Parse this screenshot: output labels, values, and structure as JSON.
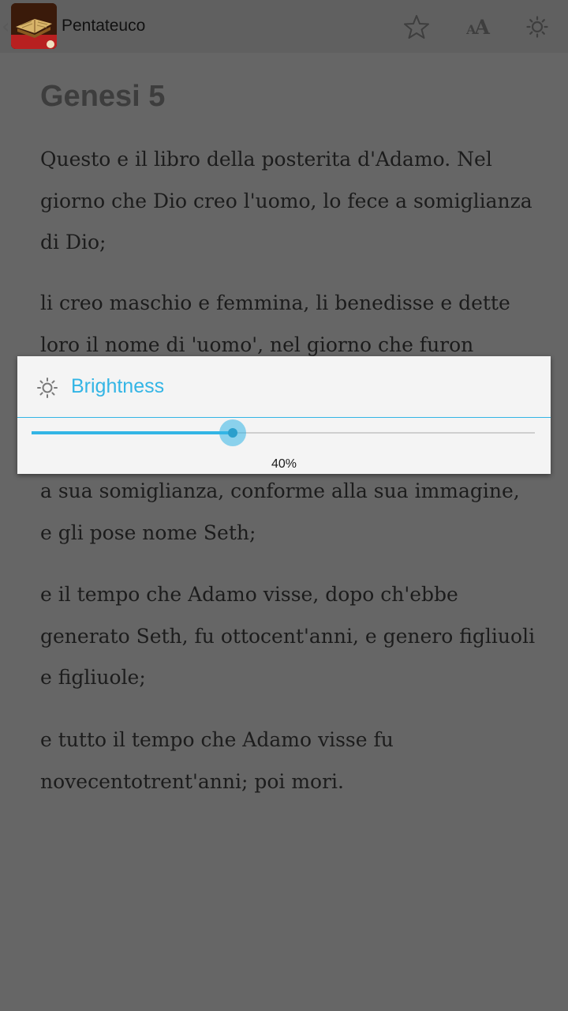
{
  "action_bar": {
    "title": "Pentateuco",
    "icons": {
      "app": "bible-book-icon",
      "favorite": "star-outline-icon",
      "font_size": "font-size-icon",
      "brightness": "brightness-icon"
    }
  },
  "content": {
    "chapter_title": "Genesi 5",
    "verses": [
      "Questo e il libro della posterita d'Adamo. Nel giorno che Dio creo l'uomo, lo fece a somiglianza di Dio;",
      "li creo maschio e femmina, li benedisse e dette loro il nome di 'uomo', nel giorno che furon",
      "a sua somiglianza, conforme alla sua immagine, e gli pose nome Seth;",
      "e il tempo che Adamo visse, dopo ch'ebbe generato Seth, fu ottocent'anni, e genero figliuoli e figliuole;",
      "e tutto il tempo che Adamo visse fu novecentotrent'anni; poi mori."
    ]
  },
  "dialog": {
    "title": "Brightness",
    "icon": "brightness-icon",
    "slider_fraction": 0.4,
    "value_label": "40%"
  },
  "colors": {
    "accent": "#33b5e5",
    "dim_background": "#666666",
    "dialog_background": "#f4f4f4"
  }
}
